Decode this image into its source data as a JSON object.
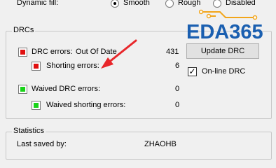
{
  "dynamic_fill": {
    "label": "Dynamic fill:",
    "options": [
      {
        "label": "Smooth",
        "checked": true
      },
      {
        "label": "Rough",
        "checked": false
      },
      {
        "label": "Disabled",
        "checked": false
      }
    ]
  },
  "drcs": {
    "group_title": "DRCs",
    "drc_errors": {
      "label": "DRC errors:",
      "status": "Out Of Date",
      "count": "431"
    },
    "shorting_errors": {
      "label": "Shorting errors:",
      "count": "6"
    },
    "waived_drc_errors": {
      "label": "Waived DRC errors:",
      "count": "0"
    },
    "waived_shorting_errors": {
      "label": "Waived shorting errors:",
      "count": "0"
    },
    "update_button": "Update DRC",
    "online_drc": {
      "label": "On-line DRC",
      "checked": true
    }
  },
  "statistics": {
    "group_title": "Statistics",
    "last_saved_label": "Last saved by:",
    "last_saved_value": "ZHAOHB"
  },
  "watermark": {
    "text": "EDA365"
  },
  "colors": {
    "red": "#e01010",
    "green": "#19d319",
    "arrow": "#e8262a",
    "logo_blue": "#1a5fb0",
    "circuit_orange": "#f2a51a"
  }
}
